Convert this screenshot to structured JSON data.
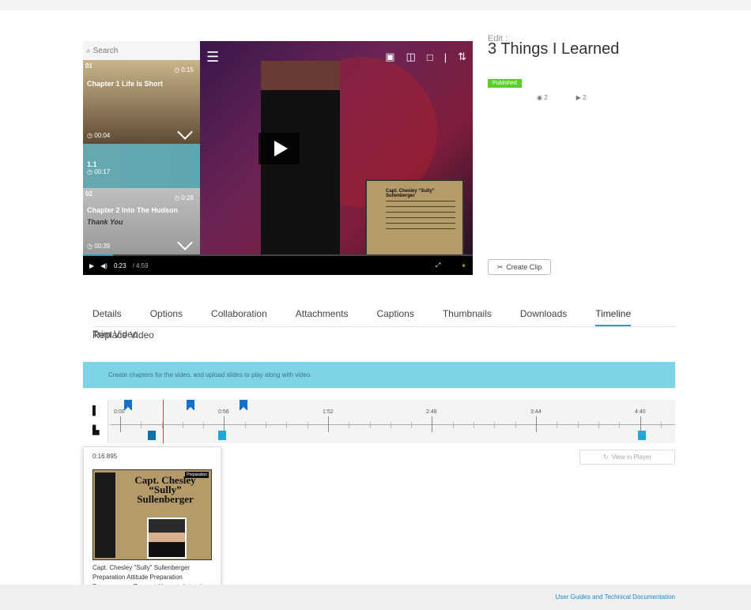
{
  "chapter_panel": {
    "search_placeholder": "Search",
    "items": [
      {
        "number": "01",
        "title": "Chapter 1 Life Is Short",
        "duration": "0:15",
        "time": "00:04"
      },
      {
        "number": "1.1",
        "title": "",
        "duration": "",
        "time": "00:17"
      },
      {
        "number": "02",
        "title": "Chapter 2 Into The Hudson",
        "subtitle": "Thank You",
        "duration": "0:28",
        "time": "00:39"
      }
    ]
  },
  "player": {
    "current_time": "0:23",
    "duration": "/ 4:59",
    "progress": 0.077,
    "slide_title": "Capt. Chesley “Sully” Sullenberger"
  },
  "header": {
    "edit_label": "Edit :",
    "title": "3 Things I Learned",
    "status": "Published",
    "views": "2",
    "plays": "2",
    "create_clip": "Create Clip"
  },
  "tabs": [
    {
      "label": "Details"
    },
    {
      "label": "Options"
    },
    {
      "label": "Collaboration"
    },
    {
      "label": "Attachments"
    },
    {
      "label": "Captions"
    },
    {
      "label": "Thumbnails"
    },
    {
      "label": "Downloads"
    },
    {
      "label": "Timeline",
      "active": true
    },
    {
      "label": "Replace Video"
    },
    {
      "label": "Trim Video"
    }
  ],
  "info": "Create chapters for the video, and upload slides to play along with video.",
  "timeline": {
    "labels": [
      "0:00",
      "0:56",
      "1:52",
      "2:48",
      "3:44",
      "4:40"
    ],
    "chapter_markers": [
      "0:04",
      "0:15",
      "0:28"
    ],
    "slide_markers": [
      "0:17",
      "0:56",
      "4:40"
    ],
    "playhead": "0:16.895"
  },
  "popover": {
    "time": "0:16.895",
    "title": "Capt. Chesley “Sully” Sullenberger",
    "tag": "Preparation",
    "text": "Capt. Chesley \"Sully\" Sullenberger Preparation Attitude Preparation Perseverance Respect Honesty Integrity Courage Appreciation Composure Empathy Gratitude Tolerance Sacrifice"
  },
  "view_player": "View in Player",
  "footer_link": "User Guides and Technical Documentation"
}
